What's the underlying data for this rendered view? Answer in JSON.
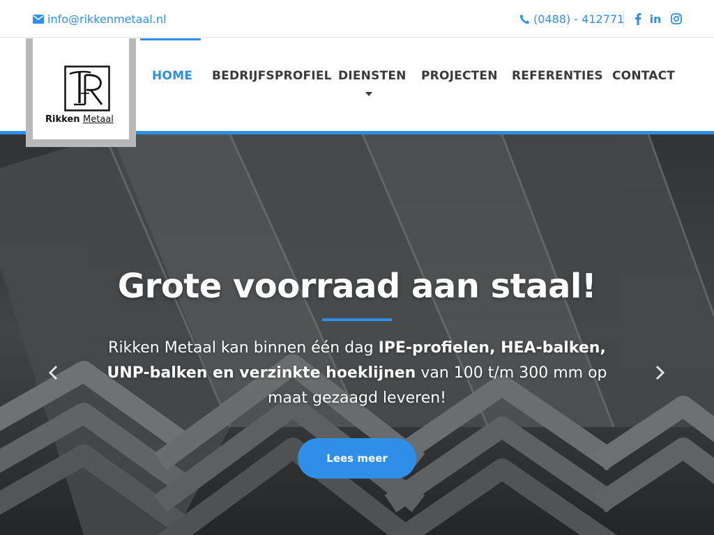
{
  "topbar": {
    "email": "info@rikkenmetaal.nl",
    "phone": "(0488) - 412771",
    "social": {
      "facebook": "f",
      "linkedin": "in",
      "instagram": "instagram-icon"
    }
  },
  "logo": {
    "monogram": "TR",
    "name_bold": "Rikken",
    "name_thin": "Metaal"
  },
  "nav": {
    "items": [
      {
        "label": "HOME",
        "active": true
      },
      {
        "label": "BEDRIJFSPROFIEL",
        "active": false
      },
      {
        "label": "DIENSTEN",
        "active": false,
        "has_dropdown": true
      },
      {
        "label": "PROJECTEN",
        "active": false
      },
      {
        "label": "REFERENTIES",
        "active": false
      },
      {
        "label": "CONTACT",
        "active": false
      }
    ]
  },
  "hero": {
    "title": "Grote voorraad aan staal!",
    "text_parts": {
      "p1": "Rikken Metaal kan binnen één dag ",
      "b1": "IPE-profielen, HEA-balken, UNP-balken en verzinkte hoeklijnen",
      "p2": " van 100 t/m 300 mm op maat gezaagd leveren!"
    },
    "button": "Lees meer"
  },
  "colors": {
    "accent": "#2f8fe8",
    "nav_text": "#3a3a3a",
    "logo_frame": "#b9b9b9"
  }
}
